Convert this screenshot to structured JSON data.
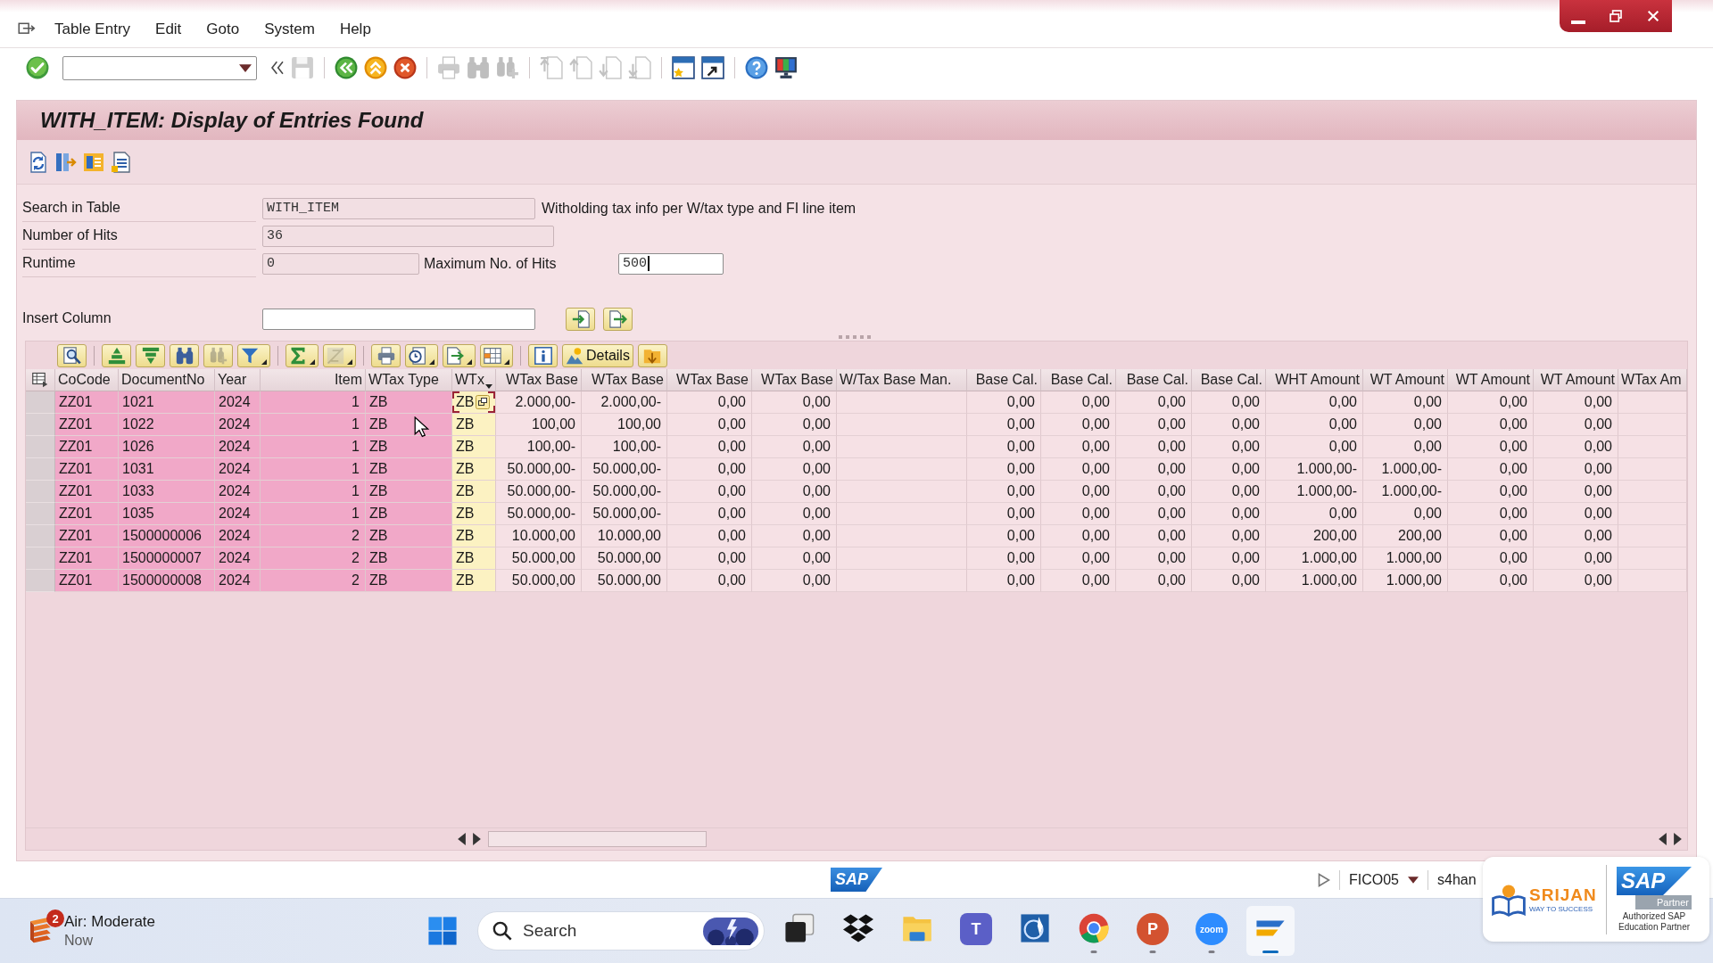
{
  "menu_bar": {
    "items": [
      {
        "label": "Table Entry"
      },
      {
        "label": "Edit"
      },
      {
        "label": "Goto"
      },
      {
        "label": "System"
      },
      {
        "label": "Help"
      }
    ]
  },
  "system_toolbar": {
    "groups": [
      [
        {
          "kind": "enter",
          "disabled": false
        },
        {
          "kind": "command-field",
          "disabled": false
        },
        {
          "kind": "collapse",
          "disabled": false
        },
        {
          "kind": "save",
          "disabled": true
        }
      ],
      [
        {
          "kind": "back",
          "disabled": false
        },
        {
          "kind": "exit",
          "disabled": false
        },
        {
          "kind": "cancel",
          "disabled": false
        }
      ],
      [
        {
          "kind": "print",
          "disabled": true
        },
        {
          "kind": "find",
          "disabled": true
        },
        {
          "kind": "find-next",
          "disabled": true
        }
      ],
      [
        {
          "kind": "first-page",
          "disabled": true
        },
        {
          "kind": "previous-page",
          "disabled": true
        },
        {
          "kind": "next-page",
          "disabled": true
        },
        {
          "kind": "last-page",
          "disabled": true
        }
      ],
      [
        {
          "kind": "new-session",
          "disabled": false
        },
        {
          "kind": "shortcut",
          "disabled": false
        }
      ],
      [
        {
          "kind": "help",
          "disabled": false
        },
        {
          "kind": "customize",
          "disabled": false
        }
      ]
    ]
  },
  "screen": {
    "title": "WITH_ITEM: Display of Entries Found"
  },
  "application_toolbar": {
    "buttons": [
      {
        "kind": "refresh"
      },
      {
        "kind": "choose-fields"
      },
      {
        "kind": "settings"
      },
      {
        "kind": "list"
      }
    ]
  },
  "form": {
    "rows": [
      {
        "label": "Search in Table",
        "field": {
          "value": "WITH_ITEM",
          "editable": false,
          "focused": false
        },
        "description": "Witholding tax info per W/tax type and FI line item"
      },
      {
        "label": "Number of Hits",
        "field": {
          "value": "36",
          "editable": false,
          "focused": false
        }
      },
      {
        "label": "Runtime",
        "field": {
          "value": "0",
          "editable": false,
          "focused": false
        },
        "extra": {
          "label": "Maximum No. of Hits",
          "field": {
            "value": "500",
            "editable": true,
            "focused": true
          }
        }
      }
    ],
    "insert_column": {
      "label": "Insert Column",
      "field": {
        "editable": true,
        "focused": false
      },
      "buttons": [
        {
          "kind": "insert-before"
        },
        {
          "kind": "insert-after"
        }
      ]
    }
  },
  "grid": {
    "toolbar": {
      "groups": [
        [
          {
            "kind": "details",
            "disabled": false,
            "menu": false
          }
        ],
        [
          {
            "kind": "sort-ascending",
            "disabled": false,
            "menu": false
          },
          {
            "kind": "sort-descending",
            "disabled": false,
            "menu": false
          },
          {
            "kind": "find",
            "disabled": false,
            "menu": false
          },
          {
            "kind": "find-next",
            "disabled": true,
            "menu": false
          },
          {
            "kind": "filter",
            "disabled": false,
            "menu": true
          }
        ],
        [
          {
            "kind": "sum",
            "disabled": false,
            "menu": true
          },
          {
            "kind": "subtotal",
            "disabled": true,
            "menu": true
          }
        ],
        [
          {
            "kind": "print",
            "disabled": false,
            "menu": false
          },
          {
            "kind": "views",
            "disabled": false,
            "menu": true
          },
          {
            "kind": "export",
            "disabled": false,
            "menu": true
          },
          {
            "kind": "layout",
            "disabled": false,
            "menu": true
          }
        ],
        [
          {
            "kind": "info",
            "disabled": false,
            "menu": false
          }
        ],
        [
          {
            "kind": "graphic-details",
            "label": "Details",
            "disabled": false,
            "menu": false
          },
          {
            "kind": "graphic",
            "disabled": false,
            "menu": false
          }
        ]
      ]
    },
    "columns": [
      {
        "label": "CoCode",
        "kind": "text",
        "key": true,
        "emphasized": false,
        "focused": false,
        "marker": false
      },
      {
        "label": "DocumentNo",
        "kind": "text",
        "key": true,
        "emphasized": false,
        "focused": false,
        "marker": false
      },
      {
        "label": "Year",
        "kind": "text",
        "key": true,
        "emphasized": false,
        "focused": false,
        "marker": false
      },
      {
        "label": "Item",
        "kind": "number",
        "key": true,
        "emphasized": false,
        "focused": false,
        "marker": false
      },
      {
        "label": "WTax Type",
        "kind": "text",
        "key": true,
        "emphasized": false,
        "focused": false,
        "marker": false
      },
      {
        "label": "WTx",
        "kind": "text",
        "key": false,
        "emphasized": true,
        "focused": true,
        "marker": true
      },
      {
        "label": "WTax Base",
        "kind": "number",
        "key": false,
        "emphasized": false,
        "focused": false,
        "marker": false
      },
      {
        "label": "WTax Base",
        "kind": "number",
        "key": false,
        "emphasized": false,
        "focused": false,
        "marker": false
      },
      {
        "label": "WTax Base",
        "kind": "number",
        "key": false,
        "emphasized": false,
        "focused": false,
        "marker": false
      },
      {
        "label": "WTax Base",
        "kind": "number",
        "key": false,
        "emphasized": false,
        "focused": false,
        "marker": false
      },
      {
        "label": "W/Tax Base Man.",
        "kind": "text",
        "key": false,
        "emphasized": false,
        "focused": false,
        "marker": false
      },
      {
        "label": "Base Cal.",
        "kind": "number",
        "key": false,
        "emphasized": false,
        "focused": false,
        "marker": false
      },
      {
        "label": "Base Cal.",
        "kind": "number",
        "key": false,
        "emphasized": false,
        "focused": false,
        "marker": false
      },
      {
        "label": "Base Cal.",
        "kind": "number",
        "key": false,
        "emphasized": false,
        "focused": false,
        "marker": false
      },
      {
        "label": "Base Cal.",
        "kind": "number",
        "key": false,
        "emphasized": false,
        "focused": false,
        "marker": false
      },
      {
        "label": "WHT Amount",
        "kind": "number",
        "key": false,
        "emphasized": false,
        "focused": false,
        "marker": false
      },
      {
        "label": "WT Amount",
        "kind": "number",
        "key": false,
        "emphasized": false,
        "focused": false,
        "marker": false
      },
      {
        "label": "WT Amount",
        "kind": "number",
        "key": false,
        "emphasized": false,
        "focused": false,
        "marker": false
      },
      {
        "label": "WT Amount",
        "kind": "number",
        "key": false,
        "emphasized": false,
        "focused": false,
        "marker": false
      },
      {
        "label": "WTax Am",
        "kind": "text",
        "key": false,
        "emphasized": false,
        "focused": false,
        "marker": false
      }
    ],
    "rows": [
      {
        "selected": false,
        "focused": true,
        "cells": [
          "ZZ01",
          "1021",
          "2024",
          "1",
          "ZB",
          "ZB",
          "2.000,00-",
          "2.000,00-",
          "0,00",
          "0,00",
          null,
          "0,00",
          "0,00",
          "0,00",
          "0,00",
          "0,00",
          "0,00",
          "0,00",
          "0,00",
          null
        ]
      },
      {
        "selected": false,
        "focused": false,
        "cells": [
          "ZZ01",
          "1022",
          "2024",
          "1",
          "ZB",
          "ZB",
          "100,00",
          "100,00",
          "0,00",
          "0,00",
          null,
          "0,00",
          "0,00",
          "0,00",
          "0,00",
          "0,00",
          "0,00",
          "0,00",
          "0,00",
          null
        ]
      },
      {
        "selected": false,
        "focused": false,
        "cells": [
          "ZZ01",
          "1026",
          "2024",
          "1",
          "ZB",
          "ZB",
          "100,00-",
          "100,00-",
          "0,00",
          "0,00",
          null,
          "0,00",
          "0,00",
          "0,00",
          "0,00",
          "0,00",
          "0,00",
          "0,00",
          "0,00",
          null
        ]
      },
      {
        "selected": false,
        "focused": false,
        "cells": [
          "ZZ01",
          "1031",
          "2024",
          "1",
          "ZB",
          "ZB",
          "50.000,00-",
          "50.000,00-",
          "0,00",
          "0,00",
          null,
          "0,00",
          "0,00",
          "0,00",
          "0,00",
          "1.000,00-",
          "1.000,00-",
          "0,00",
          "0,00",
          null
        ]
      },
      {
        "selected": false,
        "focused": false,
        "cells": [
          "ZZ01",
          "1033",
          "2024",
          "1",
          "ZB",
          "ZB",
          "50.000,00-",
          "50.000,00-",
          "0,00",
          "0,00",
          null,
          "0,00",
          "0,00",
          "0,00",
          "0,00",
          "1.000,00-",
          "1.000,00-",
          "0,00",
          "0,00",
          null
        ]
      },
      {
        "selected": false,
        "focused": false,
        "cells": [
          "ZZ01",
          "1035",
          "2024",
          "1",
          "ZB",
          "ZB",
          "50.000,00-",
          "50.000,00-",
          "0,00",
          "0,00",
          null,
          "0,00",
          "0,00",
          "0,00",
          "0,00",
          "0,00",
          "0,00",
          "0,00",
          "0,00",
          null
        ]
      },
      {
        "selected": false,
        "focused": false,
        "cells": [
          "ZZ01",
          "1500000006",
          "2024",
          "2",
          "ZB",
          "ZB",
          "10.000,00",
          "10.000,00",
          "0,00",
          "0,00",
          null,
          "0,00",
          "0,00",
          "0,00",
          "0,00",
          "200,00",
          "200,00",
          "0,00",
          "0,00",
          null
        ]
      },
      {
        "selected": false,
        "focused": false,
        "cells": [
          "ZZ01",
          "1500000007",
          "2024",
          "2",
          "ZB",
          "ZB",
          "50.000,00",
          "50.000,00",
          "0,00",
          "0,00",
          null,
          "0,00",
          "0,00",
          "0,00",
          "0,00",
          "1.000,00",
          "1.000,00",
          "0,00",
          "0,00",
          null
        ]
      },
      {
        "selected": false,
        "focused": false,
        "cells": [
          "ZZ01",
          "1500000008",
          "2024",
          "2",
          "ZB",
          "ZB",
          "50.000,00",
          "50.000,00",
          "0,00",
          "0,00",
          null,
          "0,00",
          "0,00",
          "0,00",
          "0,00",
          "1.000,00",
          "1.000,00",
          "0,00",
          "0,00",
          null
        ]
      }
    ]
  },
  "status_bar": {
    "logo": "SAP",
    "system": "FICO05",
    "server": "s4han"
  },
  "taskbar": {
    "weather": {
      "title": "Air: Moderate",
      "subtitle": "Now",
      "badge": "2"
    },
    "search": {
      "placeholder": "Search"
    },
    "apps": [
      {
        "kind": "task-view",
        "running": false,
        "active": false
      },
      {
        "kind": "box-logo",
        "running": false,
        "active": false
      },
      {
        "kind": "folder",
        "running": false,
        "active": false
      },
      {
        "kind": "team-chat",
        "label": "T",
        "running": false,
        "active": false
      },
      {
        "kind": "rocket-globe",
        "running": false,
        "active": false
      },
      {
        "kind": "browser",
        "running": true,
        "active": false
      },
      {
        "kind": "presentation",
        "label": "P",
        "running": true,
        "active": false
      },
      {
        "kind": "video-call",
        "label": "zoom",
        "running": true,
        "active": false
      },
      {
        "kind": "sap-gui",
        "running": true,
        "active": true
      }
    ]
  },
  "partner_badge": {
    "brand": "SRIJAN",
    "tagline": "WAY TO SUCCESS",
    "logo": "SAP",
    "logo_label": "Partner",
    "caption": "Authorized SAP Education Partner"
  }
}
